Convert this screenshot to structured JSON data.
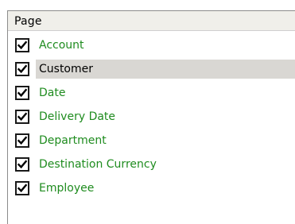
{
  "header": {
    "title": "Page"
  },
  "colors": {
    "item_text": "#1f8c1f",
    "selected_text": "#000000",
    "selected_background": "#d9d7d3",
    "header_background": "#f0efea"
  },
  "items": [
    {
      "label": "Account",
      "checked": true,
      "selected": false
    },
    {
      "label": "Customer",
      "checked": true,
      "selected": true
    },
    {
      "label": "Date",
      "checked": true,
      "selected": false
    },
    {
      "label": "Delivery Date",
      "checked": true,
      "selected": false
    },
    {
      "label": "Department",
      "checked": true,
      "selected": false
    },
    {
      "label": "Destination Currency",
      "checked": true,
      "selected": false
    },
    {
      "label": "Employee",
      "checked": true,
      "selected": false
    }
  ]
}
